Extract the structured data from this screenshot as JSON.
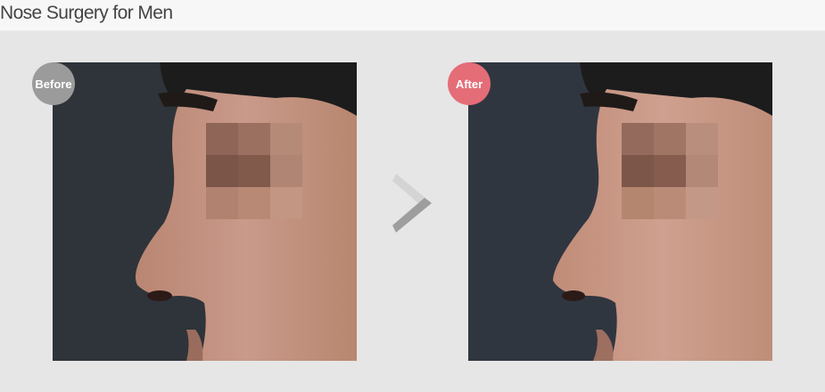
{
  "title": "Nose Surgery for Men",
  "panels": {
    "before": {
      "badge": "Before",
      "badge_color": "#9b9b9b"
    },
    "after": {
      "badge": "After",
      "badge_color": "#e46d78"
    }
  },
  "arrow_icon": "chevron-right-icon",
  "colors": {
    "background": "#e6e6e6",
    "photo_bg": "#2f353a",
    "skin": "#c49480"
  }
}
